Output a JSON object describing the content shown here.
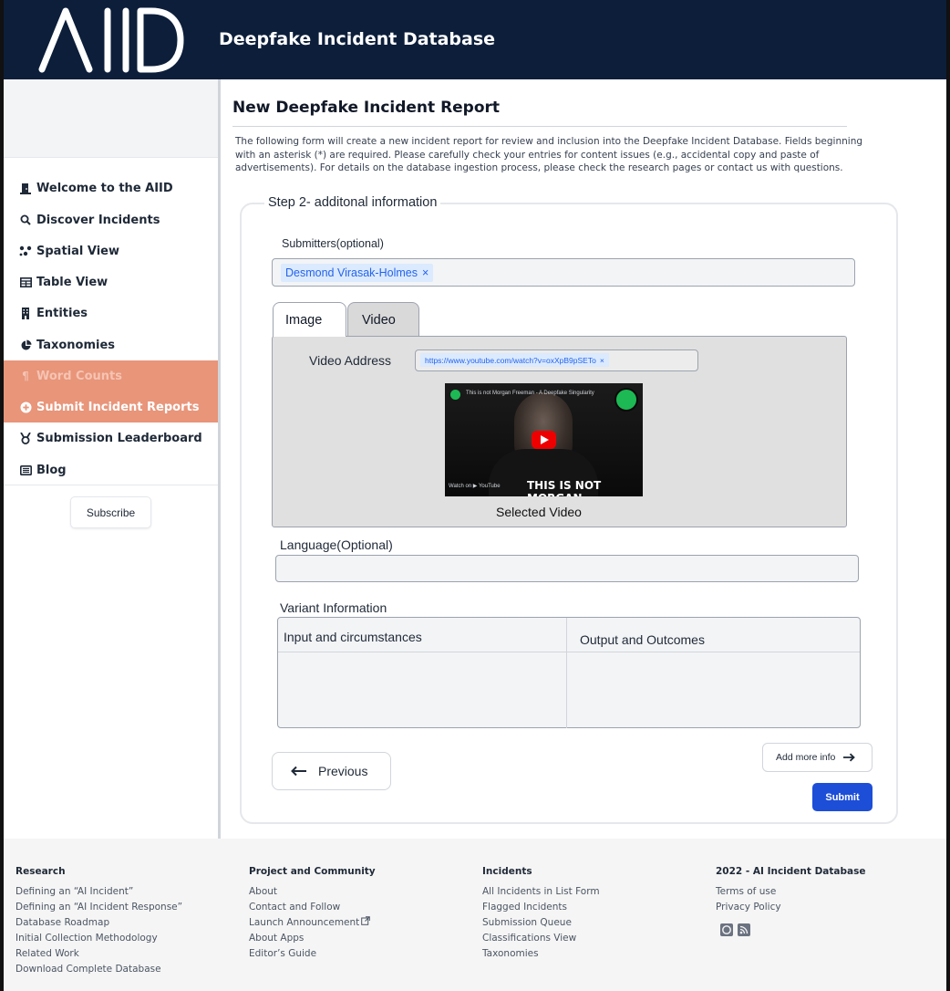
{
  "header": {
    "logo_text": "AIID",
    "site_title": "Deepfake Incident Database"
  },
  "sidebar": {
    "items": [
      {
        "label": "Welcome to the AIID",
        "icon": "door-icon"
      },
      {
        "label": "Discover Incidents",
        "icon": "search-icon"
      },
      {
        "label": "Spatial View",
        "icon": "nodes-icon"
      },
      {
        "label": "Table View",
        "icon": "table-icon"
      },
      {
        "label": "Entities",
        "icon": "building-icon"
      },
      {
        "label": "Taxonomies",
        "icon": "pie-icon"
      },
      {
        "label": "Word Counts",
        "icon": "text-icon"
      },
      {
        "label": "Submit Incident Reports",
        "icon": "plus-circle-icon"
      },
      {
        "label": "Submission Leaderboard",
        "icon": "medal-icon"
      },
      {
        "label": "Blog",
        "icon": "newspaper-icon"
      }
    ],
    "subscribe_label": "Subscribe"
  },
  "main": {
    "title": "New Deepfake Incident Report",
    "intro": "The following form will create a new incident report for review and inclusion into the Deepfake Incident Database. Fields beginning with an asterisk (*) are required. Please carefully check your entries for content issues (e.g., accidental copy and paste of advertisements). For details on the database ingestion process, please check the research pages or contact us with questions.",
    "step_title": "Step 2- additonal information",
    "submitters_label": "Submitters(optional)",
    "submitter_chip": "Desmond Virasak-Holmes",
    "chip_remove": "×",
    "tabs": [
      "Image",
      "Video"
    ],
    "video_address_label": "Video  Address",
    "video_url": "https://www.youtube.com/watch?v=oxXpB9pSETo",
    "thumb_title": "This is not Morgan Freeman - A Deepfake Singularity",
    "thumb_caption": "THIS IS NOT MORGAN FREEMAN.",
    "thumb_watch": "Watch on ▶ YouTube",
    "selected_video_label": "Selected Video",
    "language_label": "Language(Optional)",
    "language_value": "",
    "variant_label": "Variant Information",
    "variant_col1": "Input and circumstances",
    "variant_col2": "Output and Outcomes",
    "previous_label": "Previous",
    "add_more_label": "Add more info",
    "submit_label": "Submit"
  },
  "footer": {
    "columns": [
      {
        "heading": "Research",
        "links": [
          "Defining an “AI Incident”",
          "Defining an “AI Incident Response”",
          "Database Roadmap",
          "Initial Collection Methodology",
          "Related Work",
          "Download Complete Database"
        ]
      },
      {
        "heading": "Project and Community",
        "links": [
          "About",
          "Contact and Follow",
          "Launch Announcement",
          "About Apps",
          "Editor’s Guide"
        ]
      },
      {
        "heading": "Incidents",
        "links": [
          "All Incidents in List Form",
          "Flagged Incidents",
          "Submission Queue",
          "Classifications View",
          "Taxonomies"
        ]
      },
      {
        "heading": "2022 - AI Incident Database",
        "links": [
          "Terms of use",
          "Privacy Policy"
        ]
      }
    ]
  },
  "colors": {
    "header_bg": "#0c1e3a",
    "sidebar_active_bg": "#e8957a",
    "submit_bg": "#1d4ed8",
    "chip_bg": "#dbeafe",
    "chip_text": "#2563eb"
  }
}
